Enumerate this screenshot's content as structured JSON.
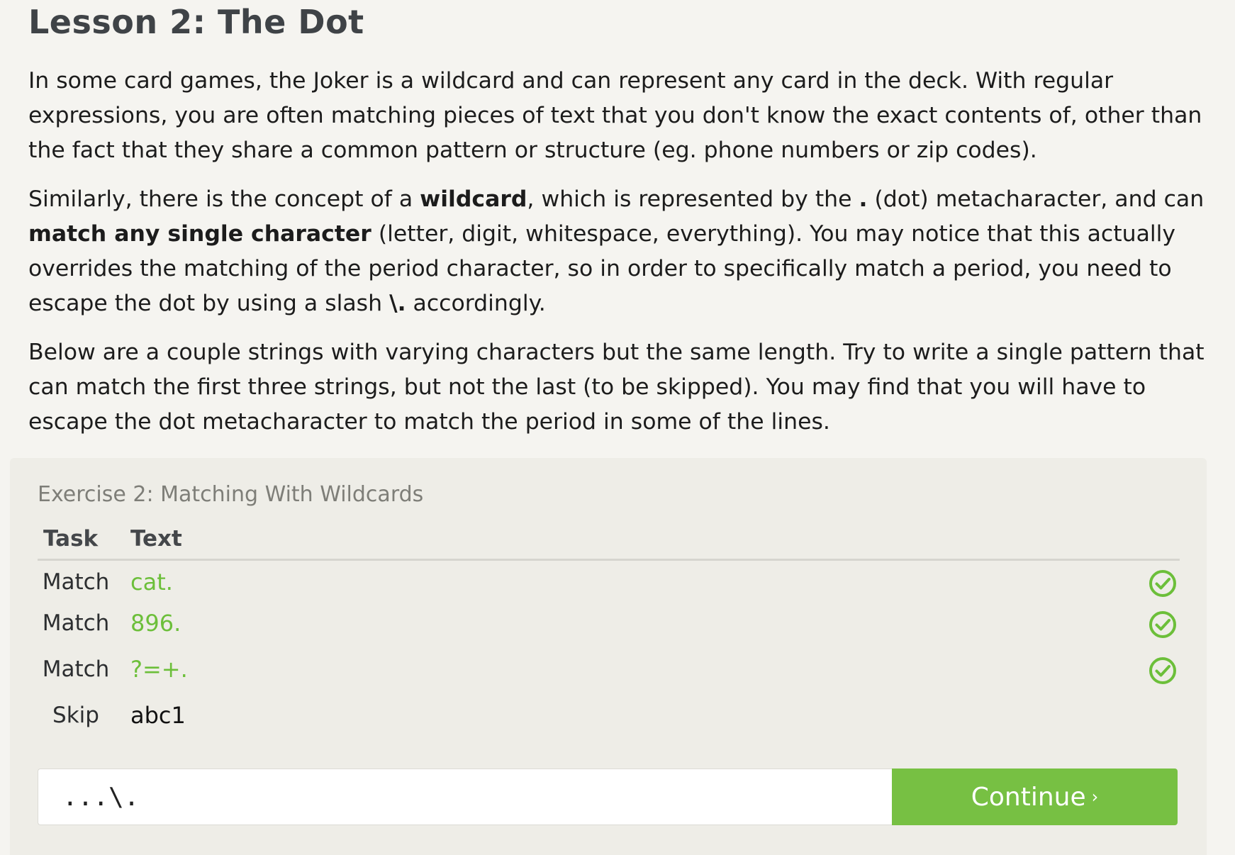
{
  "lesson": {
    "title": "Lesson 2: The Dot",
    "p1": "In some card games, the Joker is a wildcard and can represent any card in the deck. With regular expressions, you are often matching pieces of text that you don't know the exact contents of, other than the fact that they share a common pattern or structure (eg. phone numbers or zip codes).",
    "p2": {
      "a": "Similarly, there is the concept of a ",
      "b_wildcard": "wildcard",
      "c": ", which is represented by the ",
      "d_dot": ".",
      "e": " (dot) metacharacter, and can ",
      "f_match": "match any single character",
      "g": " (letter, digit, whitespace, everything). You may notice that this actually overrides the matching of the period character, so in order to specifically match a period, you need to escape the dot by using a slash ",
      "h_escape": "\\.",
      "i": " accordingly."
    },
    "p3": "Below are a couple strings with varying characters but the same length. Try to write a single pattern that can match the first three strings, but not the last (to be skipped). You may find that you will have to escape the dot metacharacter to match the period in some of the lines."
  },
  "exercise": {
    "title": "Exercise 2: Matching With Wildcards",
    "columns": {
      "task": "Task",
      "text": "Text"
    },
    "rows": [
      {
        "task": "Match",
        "text": "cat.",
        "status": "matched"
      },
      {
        "task": "Match",
        "text": "896.",
        "status": "matched"
      },
      {
        "task": "Match",
        "text": "?=+.",
        "status": "matched"
      },
      {
        "task": "Skip",
        "text": "abc1",
        "status": "none"
      }
    ],
    "input_value": "...\\.",
    "continue_label": "Continue",
    "continue_chevron": "›"
  },
  "colors": {
    "accent_green": "#77c043",
    "match_text_green": "#6cbf3a",
    "background": "#f5f4f0",
    "panel": "#eeede7"
  },
  "icons": {
    "check": "check-circle-icon"
  }
}
